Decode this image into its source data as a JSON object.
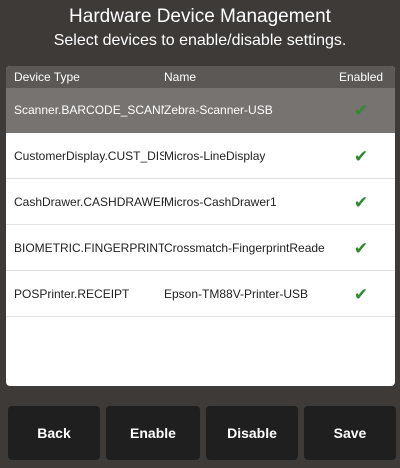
{
  "header": {
    "title": "Hardware Device Management",
    "subtitle": "Select devices to enable/disable settings."
  },
  "table": {
    "columns": {
      "device_type": "Device Type",
      "name": "Name",
      "enabled": "Enabled"
    },
    "rows": [
      {
        "device_type": "Scanner.BARCODE_SCANN",
        "name": "Zebra-Scanner-USB",
        "enabled": "✔",
        "selected": true
      },
      {
        "device_type": "CustomerDisplay.CUST_DIS",
        "name": "Micros-LineDisplay",
        "enabled": "✔",
        "selected": false
      },
      {
        "device_type": "CashDrawer.CASHDRAWER",
        "name": "Micros-CashDrawer1",
        "enabled": "✔",
        "selected": false
      },
      {
        "device_type": "BIOMETRIC.FINGERPRINT",
        "name": "Crossmatch-FingerprintReade",
        "enabled": "✔",
        "selected": false
      },
      {
        "device_type": "POSPrinter.RECEIPT",
        "name": "Epson-TM88V-Printer-USB",
        "enabled": "✔",
        "selected": false
      }
    ]
  },
  "buttons": {
    "back": "Back",
    "enable": "Enable",
    "disable": "Disable",
    "save": "Save"
  },
  "colors": {
    "background": "#3d3a38",
    "selected_row": "#777370",
    "check": "#2e8b2e",
    "button": "#1f1f1f"
  }
}
